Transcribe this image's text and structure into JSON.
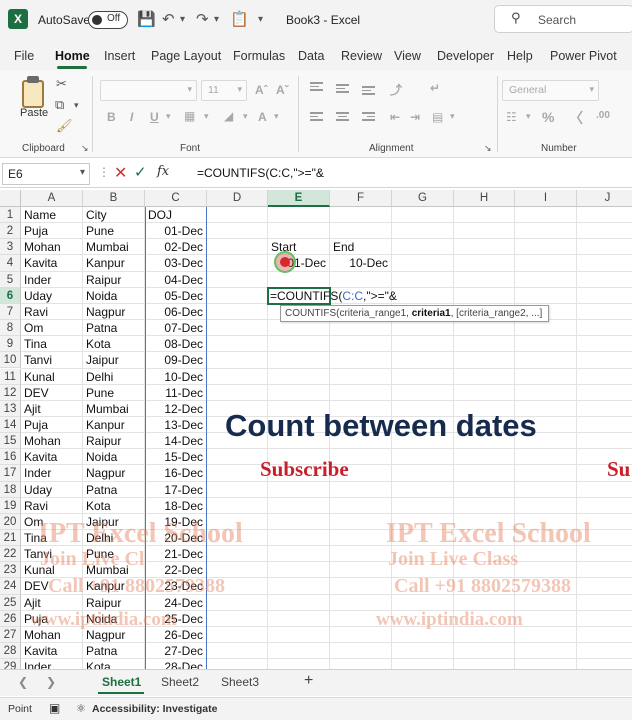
{
  "titlebar": {
    "autosave_label": "AutoSave",
    "autosave_state": "Off",
    "doc_title": "Book3 - Excel",
    "search_placeholder": "Search"
  },
  "ribbon_tabs": [
    "File",
    "Home",
    "Insert",
    "Page Layout",
    "Formulas",
    "Data",
    "Review",
    "View",
    "Developer",
    "Help",
    "Power Pivot"
  ],
  "active_tab": "Home",
  "ribbon": {
    "paste_label": "Paste",
    "groups": [
      "Clipboard",
      "Font",
      "Alignment",
      "Number"
    ],
    "font_size": "11",
    "number_format": "General"
  },
  "formula_bar": {
    "name_box": "E6",
    "formula": "=COUNTIFS(C:C,\">=\"&"
  },
  "grid": {
    "columns": [
      "A",
      "B",
      "C",
      "D",
      "E",
      "F",
      "G",
      "H",
      "I",
      "J"
    ],
    "selected_column": "E",
    "selected_row": "6",
    "rows": [
      "1",
      "2",
      "3",
      "4",
      "5",
      "6",
      "7",
      "8",
      "9",
      "10",
      "11",
      "12",
      "13",
      "14",
      "15",
      "16",
      "17",
      "18",
      "19",
      "20",
      "21",
      "22",
      "23",
      "24",
      "25",
      "26",
      "27",
      "28",
      "29"
    ],
    "headers": [
      "Name",
      "City",
      "DOJ"
    ],
    "records": [
      [
        "Puja",
        "Pune",
        "01-Dec"
      ],
      [
        "Mohan",
        "Mumbai",
        "02-Dec"
      ],
      [
        "Kavita",
        "Kanpur",
        "03-Dec"
      ],
      [
        "Inder",
        "Raipur",
        "04-Dec"
      ],
      [
        "Uday",
        "Noida",
        "05-Dec"
      ],
      [
        "Ravi",
        "Nagpur",
        "06-Dec"
      ],
      [
        "Om",
        "Patna",
        "07-Dec"
      ],
      [
        "Tina",
        "Kota",
        "08-Dec"
      ],
      [
        "Tanvi",
        "Jaipur",
        "09-Dec"
      ],
      [
        "Kunal",
        "Delhi",
        "10-Dec"
      ],
      [
        "DEV",
        "Pune",
        "11-Dec"
      ],
      [
        "Ajit",
        "Mumbai",
        "12-Dec"
      ],
      [
        "Puja",
        "Kanpur",
        "13-Dec"
      ],
      [
        "Mohan",
        "Raipur",
        "14-Dec"
      ],
      [
        "Kavita",
        "Noida",
        "15-Dec"
      ],
      [
        "Inder",
        "Nagpur",
        "16-Dec"
      ],
      [
        "Uday",
        "Patna",
        "17-Dec"
      ],
      [
        "Ravi",
        "Kota",
        "18-Dec"
      ],
      [
        "Om",
        "Jaipur",
        "19-Dec"
      ],
      [
        "Tina",
        "Delhi",
        "20-Dec"
      ],
      [
        "Tanvi",
        "Pune",
        "21-Dec"
      ],
      [
        "Kunal",
        "Mumbai",
        "22-Dec"
      ],
      [
        "DEV",
        "Kanpur",
        "23-Dec"
      ],
      [
        "Ajit",
        "Raipur",
        "24-Dec"
      ],
      [
        "Puja",
        "Noida",
        "25-Dec"
      ],
      [
        "Mohan",
        "Nagpur",
        "26-Dec"
      ],
      [
        "Kavita",
        "Patna",
        "27-Dec"
      ],
      [
        "Inder",
        "Kota",
        "28-Dec"
      ]
    ],
    "start_label": "Start",
    "end_label": "End",
    "start_value": "01-Dec",
    "end_value": "10-Dec",
    "active_cell_formula_prefix": "=COUNTIFS(",
    "active_cell_formula_ref": "C:C",
    "active_cell_formula_suffix": ",\">=\"&",
    "tooltip_fn": "COUNTIFS(criteria_range1, ",
    "tooltip_bold": "criteria1",
    "tooltip_rest": ", [criteria_range2, ...]"
  },
  "overlay": {
    "heading": "Count between dates",
    "subscribe": "Subscribe",
    "subscribe_cut": "Su",
    "watermark_title": "IPT Excel School",
    "watermark_line1": "Join Live Class",
    "watermark_line2": "Call +91 8802579388",
    "watermark_line3": "www.iptindia.com",
    "watermark_left_title": "IPT Excel School",
    "watermark_left_line1": "Join Live Cl",
    "watermark_left_line2": "Call +91 8802579388",
    "watermark_left_line3": "www.iptindia.com"
  },
  "sheets": [
    "Sheet1",
    "Sheet2",
    "Sheet3"
  ],
  "active_sheet": "Sheet1",
  "statusbar": {
    "mode": "Point",
    "accessibility": "Accessibility: Investigate"
  },
  "colors": {
    "accent": "#1d6f42",
    "heading": "#162b4e",
    "subscribe": "#c8202a",
    "range_highlight": "#4a78c9"
  }
}
